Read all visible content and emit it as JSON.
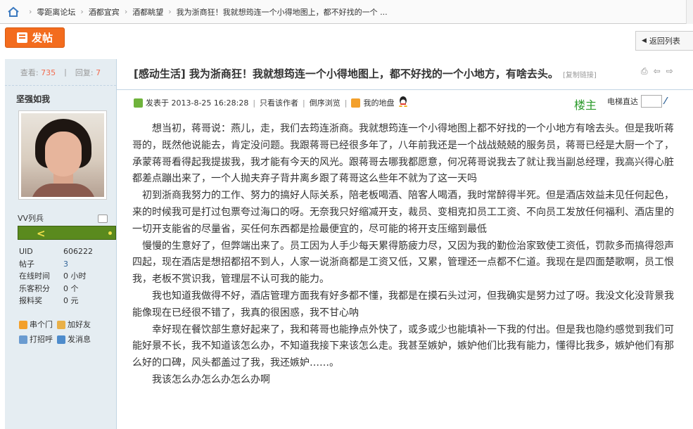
{
  "breadcrumb": {
    "items": [
      "零距离论坛",
      "酒都宜宾",
      "酒都眺望",
      "我为浙商狂！我就想筠连一个小得地图上，都不好找的一个 ..."
    ]
  },
  "toolbar": {
    "post_label": "发帖",
    "back_label": "返回列表"
  },
  "stats": {
    "views_label": "查看:",
    "views": "735",
    "replies_label": "回复:",
    "replies": "7"
  },
  "author": {
    "name": "坚强如我",
    "rank": "VV列兵",
    "fields": [
      {
        "k": "UID",
        "v": "606222"
      },
      {
        "k": "帖子",
        "v": "3"
      },
      {
        "k": "在线时间",
        "v": "0 小时"
      },
      {
        "k": "乐客积分",
        "v": "0 个"
      },
      {
        "k": "报料奖",
        "v": "0 元"
      }
    ],
    "links": [
      "串个门",
      "加好友",
      "打招呼",
      "发消息"
    ]
  },
  "thread": {
    "title": "[感动生活] 我为浙商狂！我就想筠连一个小得地图上，都不好找的一个小地方，有啥去头。",
    "copy_link": "[复制链接]",
    "posted_at": "发表于 2013-8-25 16:28:28",
    "only_author": "只看该作者",
    "reverse": "倒序浏览",
    "my_site": "我的地盘",
    "floor": "楼主",
    "elevator": "电梯直达",
    "paragraphs": [
      "　　想当初，蒋哥说：燕儿，走，我们去筠连浙商。我就想筠连一个小得地图上都不好找的一个小地方有啥去头。但是我听蒋哥的，既然他说能去，肯定没问题。我跟蒋哥已经很多年了，八年前我还是一个战战兢兢的服务员，蒋哥已经是大厨一个了，承蒙蒋哥看得起我提拔我，我才能有今天的风光。跟蒋哥去哪我都愿意，何况蒋哥说我去了就让我当副总经理，我高兴得心脏都差点蹦出来了，一个人抛夫弃子背井离乡跟了蒋哥这么些年不就为了这一天吗",
      "　初到浙商我努力的工作、努力的搞好人际关系，陪老板喝酒、陪客人喝酒，我时常醉得半死。但是酒店效益未见任何起色，来的时候我可是打过包票夸过海口的呀。无奈我只好缩减开支，裁员、变相克扣员工工资、不向员工发放任何福利、酒店里的一切开支能省的尽量省，买任何东西都是捡最便宜的，尽可能的将开支压缩到最低",
      "　慢慢的生意好了，但弊端出来了。员工因为人手少每天累得筋疲力尽，又因为我的勤俭治家致使工资低，罚款多而搞得怨声四起，现在酒店是想招都招不到人，人家一说浙商都是工资又低，又累，管理还一点都不仁道。我现在是四面楚歌啊，员工恨我，老板不赏识我，管理层不认可我的能力。",
      "　　我也知道我做得不好，酒店管理方面我有好多都不懂，我都是在摸石头过河，但我确实是努力过了呀。我没文化没背景我能像现在已经很不错了，我真的很困惑，我不甘心呐",
      "　　幸好现在餐饮部生意好起来了，我和蒋哥也能挣点外快了，或多或少也能填补一下我的付出。但是我也隐约感觉到我们可能好景不长，我不知道该怎么办，不知道我接下来该怎么走。我甚至嫉妒，嫉妒他们比我有能力，懂得比我多，嫉妒他们有那么好的口碑，风头都盖过了我，我还嫉妒……。",
      "　　我该怎么办怎么办怎么办啊"
    ]
  },
  "colors": {
    "accent_orange": "#f36c1e",
    "sidebar_bg": "#e5edf2",
    "floor_green": "#2a9a2a",
    "rank_bar": "#5a8a1e"
  }
}
